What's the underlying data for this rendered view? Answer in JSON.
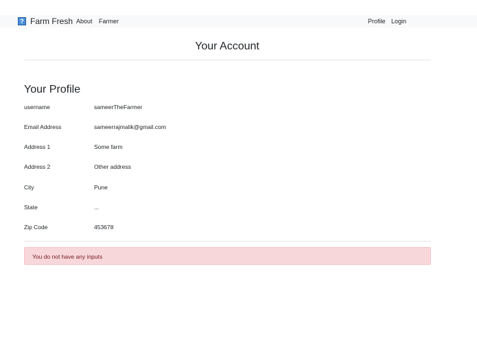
{
  "nav": {
    "brand": "Farm Fresh",
    "links": [
      "About",
      "Farmer"
    ],
    "right_links": [
      "Profile",
      "Login"
    ]
  },
  "page_title": "Your Account",
  "profile": {
    "heading": "Your Profile",
    "fields": [
      {
        "label": "username",
        "value": "sameerTheFarmer"
      },
      {
        "label": "Email Address",
        "value": "sameerrajmalik@gmail.com"
      },
      {
        "label": "Address 1",
        "value": "Some farm"
      },
      {
        "label": "Address 2",
        "value": "Other address"
      },
      {
        "label": "City",
        "value": "Pune"
      },
      {
        "label": "State",
        "value": "..."
      },
      {
        "label": "Zip Code",
        "value": "453678"
      }
    ]
  },
  "alert": {
    "text": "You do not have any inputs",
    "color": "#f8d7da"
  }
}
